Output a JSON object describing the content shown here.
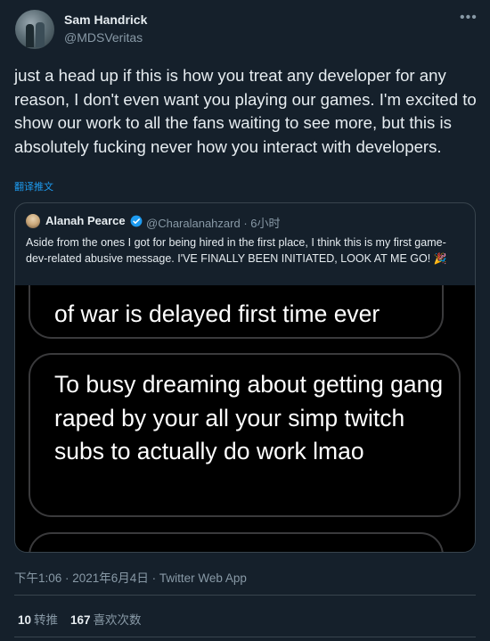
{
  "author": {
    "display_name": "Sam Handrick",
    "handle": "@MDSVeritas"
  },
  "menu_icon": "more-horizontal-icon",
  "tweet": {
    "text": "just a head up if this is how you treat any developer for any reason, I don't even want you playing our games. I'm excited to show our work to all the fans waiting to see more, but this is absolutely fucking never how you interact with developers.",
    "translate_label": "翻译推文"
  },
  "quoted_tweet": {
    "display_name": "Alanah Pearce",
    "verified": true,
    "handle_time": "@Charalanahzard · 6小时",
    "text": "Aside from the ones I got for being hired in the first place, I think this is my first game-dev-related abusive message. I'VE FINALLY BEEN INITIATED, LOOK AT ME GO!",
    "emoji": "🎉",
    "media": {
      "message_1": "of war is delayed first time ever",
      "message_2": "To busy dreaming about getting gang raped by your all your simp twitch subs to actually do work lmao"
    }
  },
  "timestamp": "下午1:06 · 2021年6月4日 · Twitter Web App",
  "stats": {
    "retweets_count": "10",
    "retweets_label": "转推",
    "likes_count": "167",
    "likes_label": "喜欢次数"
  },
  "colors": {
    "background": "#15202b",
    "text": "#e6ecf0",
    "muted": "#8899a6",
    "link": "#1d9bf0",
    "border": "#38444d"
  }
}
